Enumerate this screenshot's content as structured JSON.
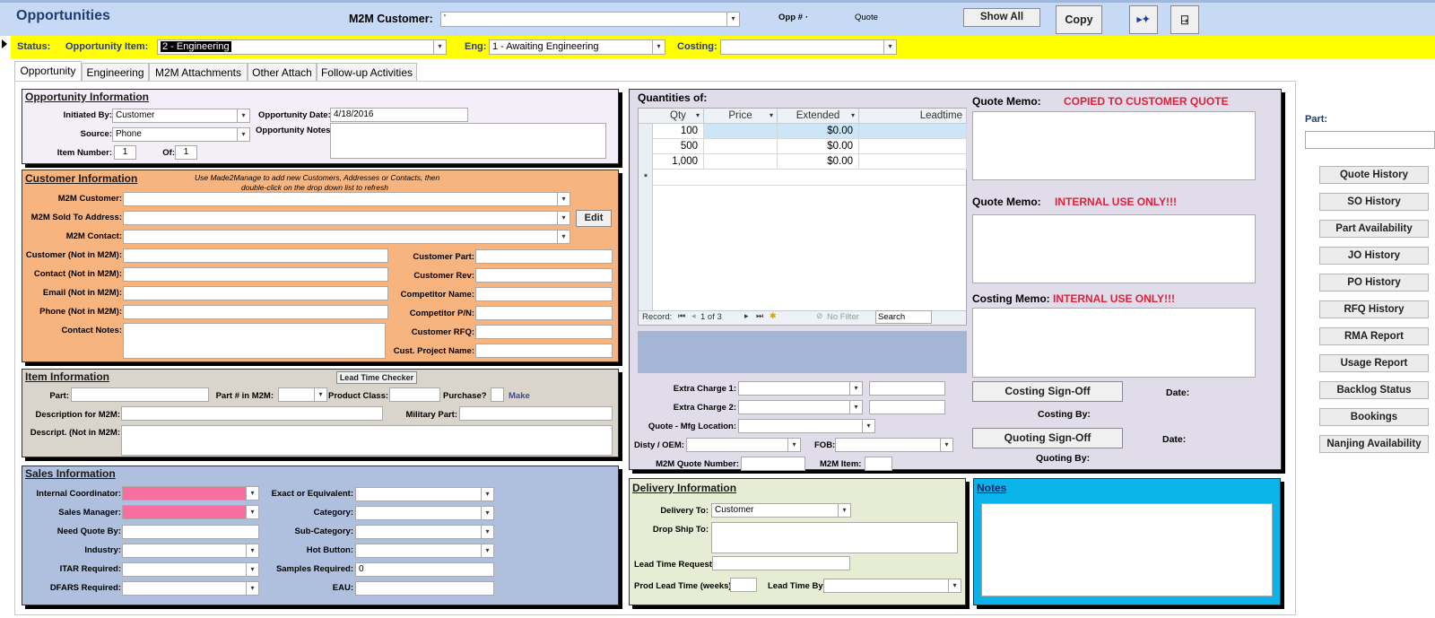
{
  "header": {
    "title": "Opportunities",
    "m2m_customer_label": "M2M Customer:",
    "m2m_customer_value": "'",
    "opp_label": "Opp #",
    "opp_value": "·",
    "quote_label": "Quote",
    "show_all": "Show All",
    "copy": "Copy"
  },
  "statusbar": {
    "status_label": "Status:",
    "item_label": "Opportunity Item:",
    "item_value": "2 - Engineering",
    "eng_label": "Eng:",
    "eng_value": "1 - Awaiting Engineering",
    "costing_label": "Costing:",
    "costing_value": ""
  },
  "tabs": [
    "Opportunity",
    "Engineering",
    "M2M Attachments",
    "Other Attach",
    "Follow-up Activities"
  ],
  "opp_info": {
    "title": "Opportunity Information",
    "initiated_by_label": "Initiated By:",
    "initiated_by": "Customer",
    "source_label": "Source:",
    "source": "Phone",
    "item_number_label": "Item Number:",
    "item_number": "1",
    "of_label": "Of:",
    "of_value": "1",
    "date_label": "Opportunity Date:",
    "date": "4/18/2016",
    "notes_label": "Opportunity Notes:"
  },
  "customer_info": {
    "title": "Customer Information",
    "hint1": "Use Made2Manage to add new Customers, Addresses or Contacts, then",
    "hint2": "double-click on the drop down list to refresh",
    "m2m_customer": "M2M Customer:",
    "sold_to": "M2M Sold To Address:",
    "contact": "M2M Contact:",
    "edit": "Edit",
    "cust_not": "Customer (Not in M2M):",
    "contact_not": "Contact (Not in M2M):",
    "email_not": "Email (Not in M2M):",
    "phone_not": "Phone (Not in M2M):",
    "contact_notes": "Contact Notes:",
    "cust_part": "Customer Part:",
    "cust_rev": "Customer Rev:",
    "competitor": "Competitor Name:",
    "competitor_pn": "Competitor P/N:",
    "cust_rfq": "Customer RFQ:",
    "project": "Cust. Project Name:"
  },
  "item_info": {
    "title": "Item Information",
    "lead_time_checker": "Lead Time Checker",
    "part": "Part:",
    "part_m2m": "Part # in M2M:",
    "product_class": "Product Class:",
    "purchase": "Purchase?",
    "make": "Make",
    "desc_m2m": "Description for M2M:",
    "military": "Military Part:",
    "desc_not": "Descript. (Not in M2M:"
  },
  "sales_info": {
    "title": "Sales Information",
    "internal": "Internal Coordinator:",
    "sales_mgr": "Sales Manager:",
    "need_quote": "Need Quote By:",
    "industry": "Industry:",
    "itar": "ITAR Required:",
    "dfars": "DFARS Required:",
    "exact": "Exact or Equivalent:",
    "category": "Category:",
    "subcategory": "Sub-Category:",
    "hot": "Hot Button:",
    "samples": "Samples Required:",
    "samples_value": "0",
    "eau": "EAU:"
  },
  "quantities": {
    "title": "Quantities of:",
    "columns": [
      "Qty",
      "Price",
      "Extended",
      "Leadtime"
    ],
    "rows": [
      [
        "100",
        "",
        "$0.00",
        ""
      ],
      [
        "500",
        "",
        "$0.00",
        ""
      ],
      [
        "1,000",
        "",
        "$0.00",
        ""
      ]
    ],
    "record_label": "Record:",
    "record_pos": "1 of 3",
    "no_filter": "No Filter",
    "search": "Search"
  },
  "charges": {
    "extra1": "Extra Charge 1:",
    "extra2": "Extra Charge 2:",
    "mfg_loc": "Quote - Mfg Location:",
    "disty": "Disty / OEM:",
    "fob": "FOB:",
    "m2m_quote": "M2M Quote Number:",
    "m2m_item": "M2M Item:"
  },
  "memos": {
    "quote_memo_label": "Quote Memo:",
    "quote_memo_tag": "COPIED TO CUSTOMER QUOTE",
    "internal_memo_label": "Quote Memo:",
    "internal_memo_tag": "INTERNAL USE ONLY!!!",
    "costing_memo_label": "Costing Memo:",
    "costing_memo_tag": "INTERNAL USE ONLY!!!",
    "costing_signoff": "Costing Sign-Off",
    "date1": "Date:",
    "costing_by": "Costing By:",
    "quoting_signoff": "Quoting Sign-Off",
    "date2": "Date:",
    "quoting_by": "Quoting By:"
  },
  "delivery": {
    "title": "Delivery Information",
    "delivery_to": "Delivery To:",
    "delivery_to_value": "Customer",
    "drop_ship": "Drop Ship To:",
    "lead_req": "Lead Time Request:",
    "prod_lead": "Prod Lead Time (weeks):",
    "lead_by": "Lead Time By:"
  },
  "notes": {
    "title": "Notes"
  },
  "right": {
    "part_label": "Part:",
    "buttons": [
      "Quote History",
      "SO History",
      "Part Availability",
      "JO History",
      "PO History",
      "RFQ History",
      "RMA Report",
      "Usage Report",
      "Backlog Status",
      "Bookings",
      "Nanjing Availability"
    ]
  },
  "colors": {
    "header_bg": "#c6d9f5",
    "status_bg": "#ffff00",
    "opp_bg": "#f3eef8",
    "cust_bg": "#f8b47e",
    "item_bg": "#d9d4cc",
    "sales_bg": "#aec0de",
    "qty_bg": "#e0dcea",
    "delivery_bg": "#e7ecd5",
    "notes_bg": "#0ab4ea",
    "pink": "#f76fa0",
    "red": "#e0203a"
  }
}
